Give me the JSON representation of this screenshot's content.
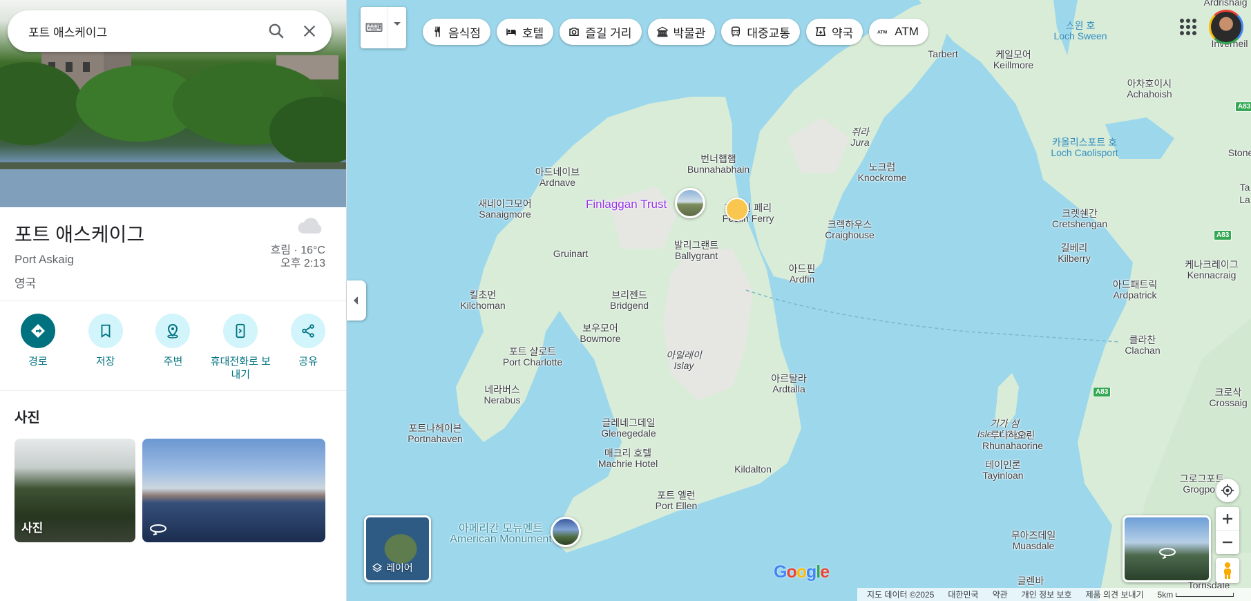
{
  "search": {
    "query": "포트 애스케이그"
  },
  "place": {
    "title": "포트 애스케이그",
    "subtitle": "Port Askaig",
    "country": "영국",
    "weather": "흐림 · 16°C",
    "time": "오후 2:13"
  },
  "actions": [
    {
      "label": "경로",
      "icon": "directions-icon"
    },
    {
      "label": "저장",
      "icon": "bookmark-icon"
    },
    {
      "label": "주변",
      "icon": "nearby-icon"
    },
    {
      "label": "휴대전화로 보내기",
      "icon": "send-to-phone-icon"
    },
    {
      "label": "공유",
      "icon": "share-icon"
    }
  ],
  "photos": {
    "heading": "사진",
    "tile1_caption": "사진"
  },
  "chips": [
    {
      "label": "음식점",
      "icon": "restaurant-icon"
    },
    {
      "label": "호텔",
      "icon": "hotel-icon"
    },
    {
      "label": "즐길 거리",
      "icon": "camera-icon"
    },
    {
      "label": "박물관",
      "icon": "museum-icon"
    },
    {
      "label": "대중교통",
      "icon": "transit-icon"
    },
    {
      "label": "약국",
      "icon": "pharmacy-icon"
    },
    {
      "label": "ATM",
      "icon": "atm-icon"
    }
  ],
  "map_labels": {
    "tarbert": "Tarbert",
    "loch_sween_ko": "스윈 호",
    "loch_sween": "Loch Sween",
    "keillmore_ko": "케일모어",
    "keillmore": "Keillmore",
    "achahoish_ko": "아차호이시",
    "achahoish": "Achahoish",
    "inverneil": "Inverneil",
    "jura_ko": "쥐라",
    "jura": "Jura",
    "loch_caolisport_ko": "카올리스포트 호",
    "loch_caolisport": "Loch Caolisport",
    "bunnahabhain_ko": "번너햅햄",
    "bunnahabhain": "Bunnahabhain",
    "knockrome_ko": "노크럼",
    "knockrome": "Knockrome",
    "ardnave_ko": "아드네이브",
    "ardnave": "Ardnave",
    "sanaigmore_ko": "새네이그모어",
    "sanaigmore": "Sanaigmore",
    "finlaggan": "Finlaggan Trust",
    "feolin_ko": "피올린 페리",
    "feolin": "Feolin Ferry",
    "craighouse_ko": "크렉하우스",
    "craighouse": "Craighouse",
    "cretshengan_ko": "크렛쉔간",
    "cretshengan": "Cretshengan",
    "kilberry_ko": "길베리",
    "kilberry": "Kilberry",
    "ballygrant_ko": "발리그랜트",
    "ballygrant": "Ballygrant",
    "gruinart": "Gruinart",
    "ardfin_ko": "아드핀",
    "ardfin": "Ardfin",
    "kennacraig_ko": "케나크레이그",
    "kennacraig": "Kennacraig",
    "ardpatrick_ko": "아드패트릭",
    "ardpatrick": "Ardpatrick",
    "kilchoman_ko": "킬초먼",
    "kilchoman": "Kilchoman",
    "bridgend_ko": "브리젠드",
    "bridgend": "Bridgend",
    "bowmore_ko": "보우모어",
    "bowmore": "Bowmore",
    "port_charlotte_ko": "포트 샬로트",
    "port_charlotte": "Port Charlotte",
    "islay_ko": "아일레이",
    "islay": "Islay",
    "clachan_ko": "클라찬",
    "clachan": "Clachan",
    "ardtalla_ko": "아르탈라",
    "ardtalla": "Ardtalla",
    "nerabus_ko": "네라버스",
    "nerabus": "Nerabus",
    "crossaig_ko": "크로삭",
    "crossaig": "Crossaig",
    "gigha_ko": "기가 섬",
    "gigha": "Isle of Gigha",
    "portnahaven_ko": "포트나헤이븐",
    "portnahaven": "Portnahaven",
    "glenegedale_ko": "글레네그데일",
    "glenegedale": "Glenegedale",
    "rhunahaorine_ko": "루나하오린",
    "rhunahaorine": "Rhunahaorine",
    "tayinloan_ko": "테이인론",
    "tayinloan": "Tayinloan",
    "machrie_ko": "매크리 호텔",
    "machrie": "Machrie Hotel",
    "kildalton": "Kildalton",
    "grogport_ko": "그로그포트",
    "grogport": "Grogport",
    "port_ellen_ko": "포트 엘런",
    "port_ellen": "Port Ellen",
    "american_monument_ko": "아메리칸 모뉴멘트",
    "american_monument": "American Monument",
    "muasdale_ko": "무아즈데일",
    "muasdale": "Muasdale",
    "glenbarr_ko": "글렌바",
    "torrisdale": "Torrisdale",
    "stone": "Stone",
    "ta": "Ta",
    "la": "La",
    "ardrishaig": "Ardrishaig",
    "a83": "A83"
  },
  "layers_label": "레이어",
  "google_logo": "Google",
  "footer": {
    "data": "지도 데이터 ©2025",
    "country": "대한민국",
    "terms": "약관",
    "privacy": "개인 정보 보호",
    "feedback": "제품 의견 보내기",
    "scale": "5km"
  }
}
